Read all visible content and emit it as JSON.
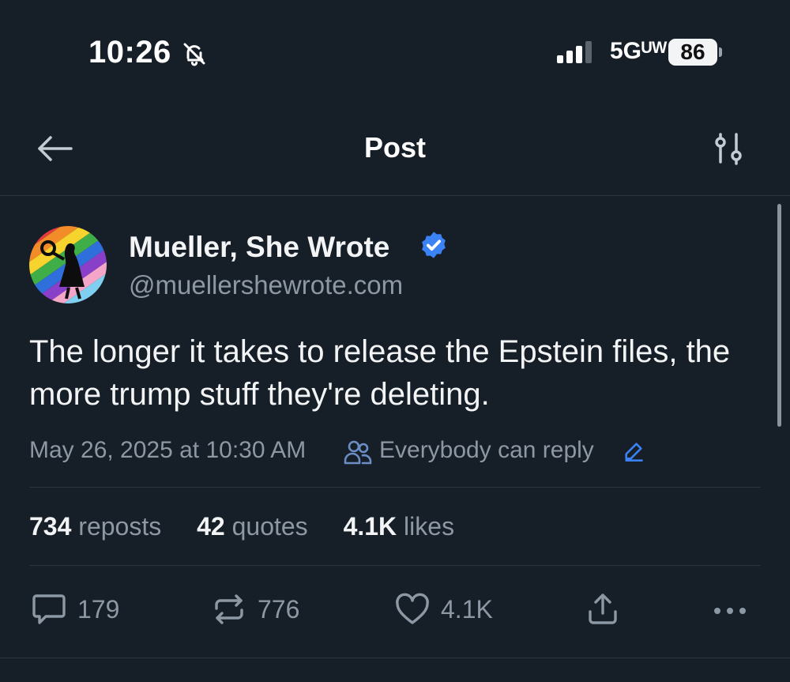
{
  "status_bar": {
    "time": "10:26",
    "network": "5Gᵁᵂ",
    "battery": "86",
    "icons": [
      "bell-slash-icon",
      "cellular-signal-icon",
      "battery-icon"
    ]
  },
  "header": {
    "title": "Post",
    "icons": [
      "back-arrow-icon",
      "filter-sliders-icon"
    ]
  },
  "post": {
    "author": {
      "name": "Mueller, She Wrote",
      "handle": "@muellershewrote.com",
      "verified": true
    },
    "text": "The longer it takes to release the Epstein files, the more trump stuff they're deleting.",
    "timestamp": "May 26, 2025 at 10:30 AM",
    "reply_setting": "Everybody can reply",
    "stats": {
      "reposts_count": "734",
      "reposts_label": "reposts",
      "quotes_count": "42",
      "quotes_label": "quotes",
      "likes_count": "4.1K",
      "likes_label": "likes"
    },
    "actions": {
      "replies": "179",
      "reposts": "776",
      "likes": "4.1K"
    }
  },
  "colors": {
    "background": "#161e27",
    "primary_text": "#f3f4f6",
    "secondary_text": "#8d98a5",
    "accent": "#3b82f6",
    "divider": "#2a333e"
  }
}
